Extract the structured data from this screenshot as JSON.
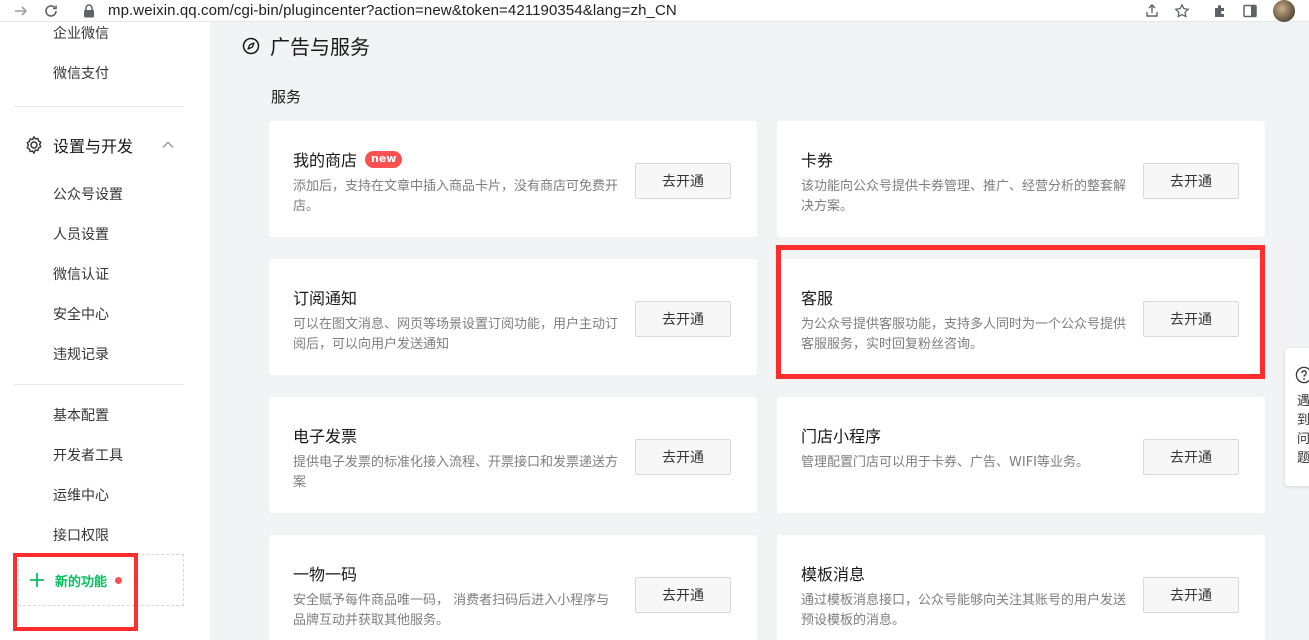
{
  "browser": {
    "url": "mp.weixin.qq.com/cgi-bin/plugincenter?action=new&token=421190354&lang=zh_CN"
  },
  "sidebar": {
    "top_items": [
      "企业微信",
      "微信支付"
    ],
    "group_title": "设置与开发",
    "group_items": [
      "公众号设置",
      "人员设置",
      "微信认证",
      "安全中心",
      "违规记录"
    ],
    "dev_items": [
      "基本配置",
      "开发者工具",
      "运维中心",
      "接口权限"
    ],
    "new_feature_label": "新的功能"
  },
  "main": {
    "page_title": "广告与服务",
    "section_title": "服务",
    "cards": [
      {
        "title": "我的商店",
        "badge": "new",
        "desc": "添加后，支持在文章中插入商品卡片，没有商店可免费开店。",
        "button": "去开通"
      },
      {
        "title": "卡券",
        "badge": "",
        "desc": "该功能向公众号提供卡券管理、推广、经营分析的整套解决方案。",
        "button": "去开通"
      },
      {
        "title": "订阅通知",
        "badge": "",
        "desc": "可以在图文消息、网页等场景设置订阅功能，用户主动订阅后，可以向用户发送通知",
        "button": "去开通"
      },
      {
        "title": "客服",
        "badge": "",
        "desc": "为公众号提供客服功能，支持多人同时为一个公众号提供客服服务，实时回复粉丝咨询。",
        "button": "去开通"
      },
      {
        "title": "电子发票",
        "badge": "",
        "desc": "提供电子发票的标准化接入流程、开票接口和发票递送方案",
        "button": "去开通"
      },
      {
        "title": "门店小程序",
        "badge": "",
        "desc": "管理配置门店可以用于卡券、广告、WIFI等业务。",
        "button": "去开通"
      },
      {
        "title": "一物一码",
        "badge": "",
        "desc": "安全赋予每件商品唯一码， 消费者扫码后进入小程序与品牌互动并获取其他服务。",
        "button": "去开通"
      },
      {
        "title": "模板消息",
        "badge": "",
        "desc": "通过模板消息接口，公众号能够向关注其账号的用户发送预设模板的消息。",
        "button": "去开通"
      }
    ]
  },
  "help": {
    "text": "遇到问题"
  },
  "colors": {
    "accent": "#07c160",
    "highlight": "#ff2d2d",
    "badge": "#fa5151"
  }
}
